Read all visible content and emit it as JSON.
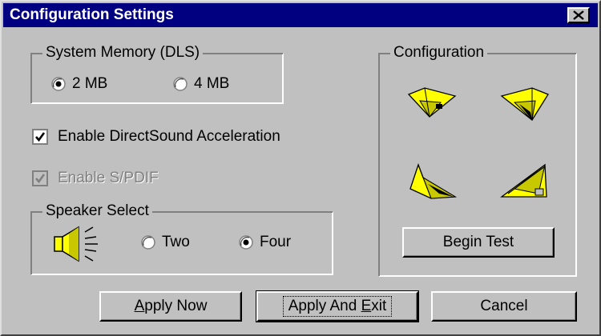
{
  "window": {
    "title": "Configuration Settings"
  },
  "memory": {
    "legend": "System Memory (DLS)",
    "options": [
      {
        "label": "2 MB",
        "selected": true
      },
      {
        "label": "4 MB",
        "selected": false
      }
    ]
  },
  "checkboxes": {
    "directsound": {
      "label": "Enable DirectSound Acceleration",
      "checked": true,
      "enabled": true
    },
    "spdif": {
      "label": "Enable S/PDIF",
      "checked": true,
      "enabled": false
    }
  },
  "speaker": {
    "legend": "Speaker Select",
    "options": [
      {
        "label": "Two",
        "selected": false
      },
      {
        "label": "Four",
        "selected": true
      }
    ]
  },
  "configuration": {
    "legend": "Configuration",
    "begin_test_label": "Begin Test",
    "speakers": [
      "front-left-speaker-icon",
      "front-right-speaker-icon",
      "rear-left-speaker-icon",
      "rear-right-speaker-icon"
    ]
  },
  "buttons": {
    "apply_now": {
      "mnemonic": "A",
      "rest": "pply Now"
    },
    "apply_exit": {
      "pre": "Apply And ",
      "mnemonic": "E",
      "rest": "xit"
    },
    "cancel": "Cancel"
  },
  "colors": {
    "titlebar": "#000080",
    "face": "#c0c0c0",
    "speaker_yellow": "#ffff00"
  }
}
